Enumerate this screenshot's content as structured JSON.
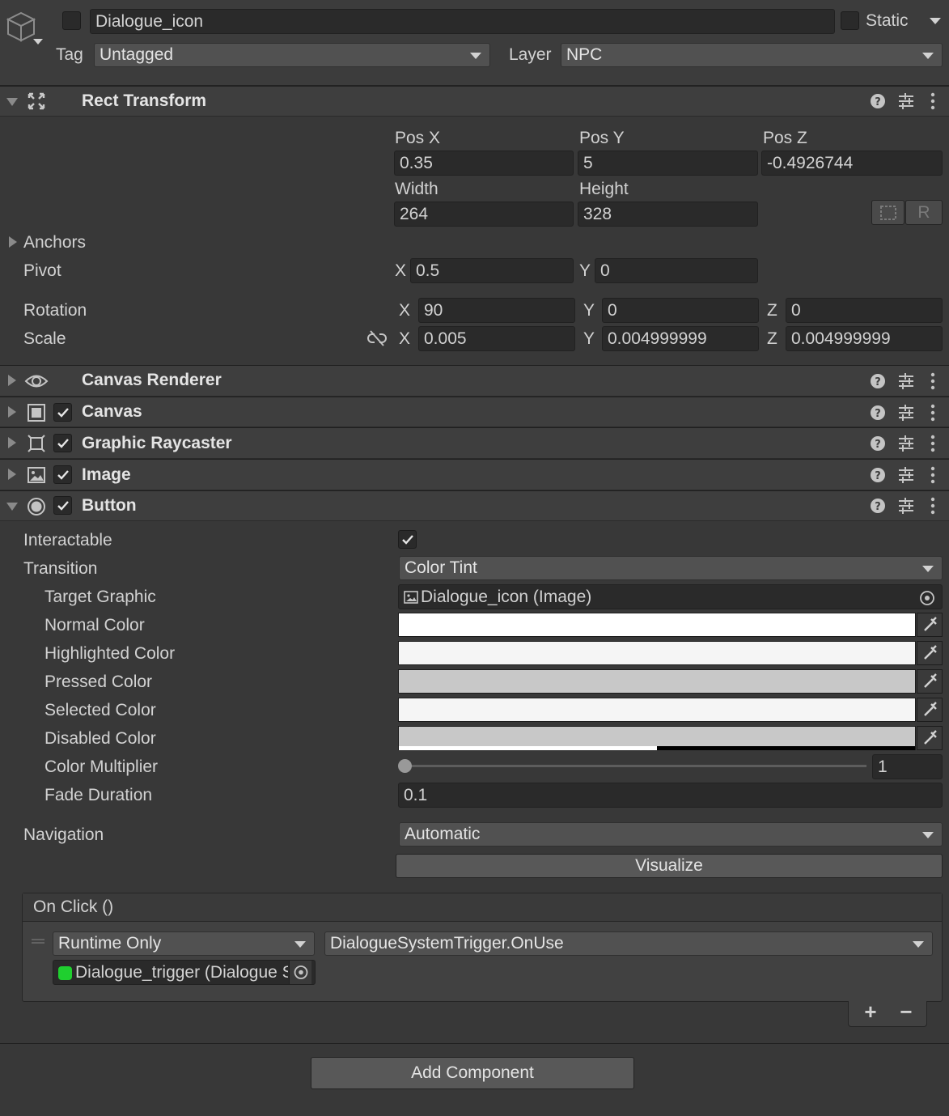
{
  "object": {
    "name": "Dialogue_icon",
    "static_label": "Static",
    "tag_label": "Tag",
    "tag_value": "Untagged",
    "layer_label": "Layer",
    "layer_value": "NPC"
  },
  "rect_transform": {
    "title": "Rect Transform",
    "pos_x_label": "Pos X",
    "pos_y_label": "Pos Y",
    "pos_z_label": "Pos Z",
    "pos_x": "0.35",
    "pos_y": "5",
    "pos_z": "-0.4926744",
    "width_label": "Width",
    "height_label": "Height",
    "width": "264",
    "height": "328",
    "raw_edit_label": "R",
    "anchors_label": "Anchors",
    "pivot_label": "Pivot",
    "pivot_x": "0.5",
    "pivot_y": "0",
    "rotation_label": "Rotation",
    "rot_x": "90",
    "rot_y": "0",
    "rot_z": "0",
    "scale_label": "Scale",
    "scale_x": "0.005",
    "scale_y": "0.004999999",
    "scale_z": "0.004999999",
    "axis_x": "X",
    "axis_y": "Y",
    "axis_z": "Z"
  },
  "components": {
    "canvas_renderer": "Canvas Renderer",
    "canvas": "Canvas",
    "graphic_raycaster": "Graphic Raycaster",
    "image": "Image",
    "button": "Button"
  },
  "button": {
    "interactable_label": "Interactable",
    "interactable": true,
    "transition_label": "Transition",
    "transition_value": "Color Tint",
    "target_graphic_label": "Target Graphic",
    "target_graphic_value": "Dialogue_icon (Image)",
    "normal_color_label": "Normal Color",
    "highlighted_color_label": "Highlighted Color",
    "pressed_color_label": "Pressed Color",
    "selected_color_label": "Selected Color",
    "disabled_color_label": "Disabled Color",
    "colors": {
      "normal": "#ffffff",
      "highlighted": "#f5f5f5",
      "pressed": "#c8c8c8",
      "selected": "#f5f5f5",
      "disabled": "#c8c8c8"
    },
    "disabled_alpha": 0.5,
    "color_multiplier_label": "Color Multiplier",
    "color_multiplier_value": "1",
    "color_multiplier_fraction": 0,
    "fade_duration_label": "Fade Duration",
    "fade_duration_value": "0.1",
    "navigation_label": "Navigation",
    "navigation_value": "Automatic",
    "visualize_label": "Visualize"
  },
  "on_click": {
    "header": "On Click ()",
    "runtime_value": "Runtime Only",
    "function_value": "DialogueSystemTrigger.OnUse",
    "object_value": "Dialogue_trigger (Dialogue S",
    "add_label": "+",
    "remove_label": "−"
  },
  "footer": {
    "add_component_label": "Add Component"
  }
}
